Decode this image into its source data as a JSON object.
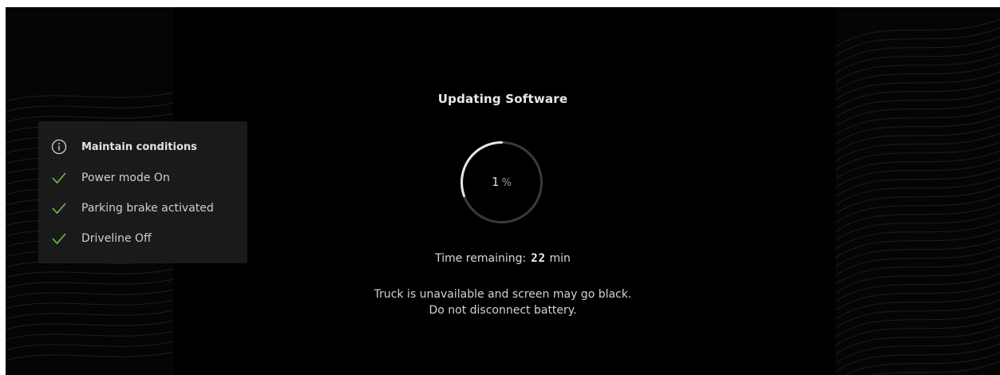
{
  "update": {
    "title": "Updating Software",
    "progress_percent": 1,
    "progress_unit": "%",
    "time_remaining_label": "Time remaining:",
    "time_remaining_value": "22",
    "time_remaining_unit": "min",
    "warning_line1": "Truck is unavailable and screen may go black.",
    "warning_line2": "Do not disconnect battery."
  },
  "conditions": {
    "header_icon": "info-icon",
    "header": "Maintain conditions",
    "items": [
      {
        "icon": "check-icon",
        "label": "Power mode On"
      },
      {
        "icon": "check-icon",
        "label": "Parking brake activated"
      },
      {
        "icon": "check-icon",
        "label": "Driveline Off"
      }
    ]
  },
  "colors": {
    "background": "#000000",
    "check": "#6cc04a",
    "ring_track": "#3a3a3a",
    "ring_progress": "#e6e6e6"
  }
}
